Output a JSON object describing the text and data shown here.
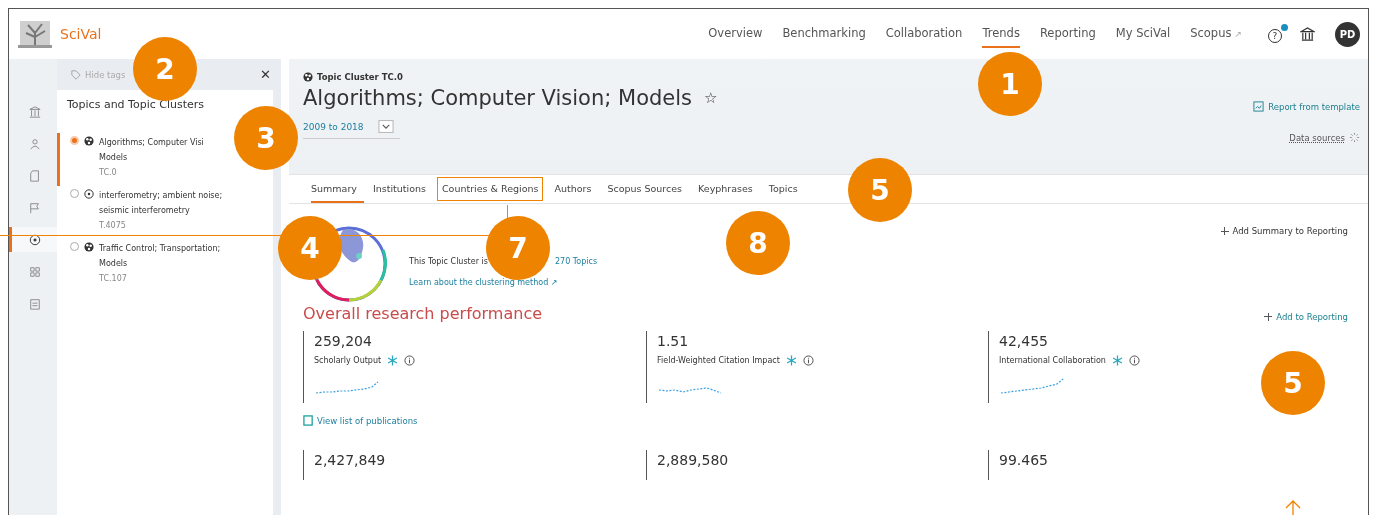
{
  "header": {
    "brand": "SciVal",
    "nav": [
      {
        "label": "Overview",
        "selected": false
      },
      {
        "label": "Benchmarking",
        "selected": false
      },
      {
        "label": "Collaboration",
        "selected": false
      },
      {
        "label": "Trends",
        "selected": true
      },
      {
        "label": "Reporting",
        "selected": false
      },
      {
        "label": "My SciVal",
        "selected": false
      },
      {
        "label": "Scopus",
        "selected": false,
        "suffix": "↗"
      }
    ],
    "help": "?",
    "avatar": "PD"
  },
  "rail": [
    {
      "kind": "bank",
      "selected": false
    },
    {
      "kind": "person",
      "selected": false
    },
    {
      "kind": "document",
      "selected": false
    },
    {
      "kind": "flag",
      "selected": false
    },
    {
      "kind": "target",
      "selected": true
    },
    {
      "kind": "grid",
      "selected": false
    },
    {
      "kind": "calendar",
      "selected": false
    }
  ],
  "panel": {
    "hide_tags": "Hide tags",
    "close": "✕",
    "title": "Topics and Topic Clusters",
    "items": [
      {
        "kind": "cluster",
        "lines": [
          "Algorithms; Computer Visi",
          "Models"
        ],
        "code": "TC.0",
        "selected": true
      },
      {
        "kind": "topic",
        "lines": [
          "interferometry; ambient noise;",
          "seismic interferometry"
        ],
        "code": "T.4075",
        "selected": false
      },
      {
        "kind": "cluster",
        "lines": [
          "Traffic Control; Transportation;",
          "Models"
        ],
        "code": "TC.107",
        "selected": false
      }
    ]
  },
  "topic": {
    "label": "Topic Cluster TC.0",
    "title": "Algorithms; Computer Vision; Models",
    "star": "☆",
    "period": "2009 to 2018",
    "report": "Report from template",
    "data_sources": "Data sources"
  },
  "tabs": [
    {
      "label": "Summary",
      "selected": true,
      "highlighted": false
    },
    {
      "label": "Institutions",
      "selected": false,
      "highlighted": false
    },
    {
      "label": "Countries & Regions",
      "selected": false,
      "highlighted": true
    },
    {
      "label": "Authors",
      "selected": false,
      "highlighted": false
    },
    {
      "label": "Scopus Sources",
      "selected": false,
      "highlighted": false
    },
    {
      "label": "Keyphrases",
      "selected": false,
      "highlighted": false
    },
    {
      "label": "Topics",
      "selected": false,
      "highlighted": false
    }
  ],
  "summary": {
    "add": "Add Summary to Reporting",
    "cluster_text": "This Topic Cluster is",
    "topics_link": "270 Topics",
    "learn": "Learn about the clustering method ↗"
  },
  "performance": {
    "title": "Overall research performance",
    "add": "Add to Reporting",
    "metrics": [
      {
        "value": "259,204",
        "label": "Scholarly Output"
      },
      {
        "value": "1.51",
        "label": "Field-Weighted Citation Impact"
      },
      {
        "value": "42,455",
        "label": "International Collaboration"
      }
    ],
    "view_list": "View list of publications",
    "more_values": [
      "2,427,849",
      "2,889,580",
      "99.465"
    ]
  },
  "callouts": [
    "1",
    "2",
    "3",
    "4",
    "7",
    "8",
    "5",
    "5"
  ]
}
